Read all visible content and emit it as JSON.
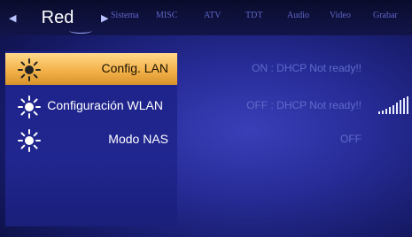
{
  "header": {
    "active_tab": "Red",
    "tabs": [
      "Sistema",
      "MISC",
      "ATV",
      "TDT",
      "Audio",
      "Video",
      "Grabar"
    ]
  },
  "menu": {
    "items": [
      {
        "label": "Config. LAN",
        "value": "ON : DHCP Not ready!!",
        "selected": true
      },
      {
        "label": "Configuración WLAN",
        "value": "OFF : DHCP Not ready!!",
        "selected": false
      },
      {
        "label": "Modo NAS",
        "value": "OFF",
        "selected": false
      }
    ]
  },
  "icons": {
    "menu_item_icon": "sun-icon",
    "wlan_indicator": "signal-strength-icon"
  },
  "colors": {
    "selected_gradient_top": "#ffd98a",
    "selected_gradient_bottom": "#d8922b",
    "value_text": "#5f6cc9",
    "background": "#272c98"
  }
}
